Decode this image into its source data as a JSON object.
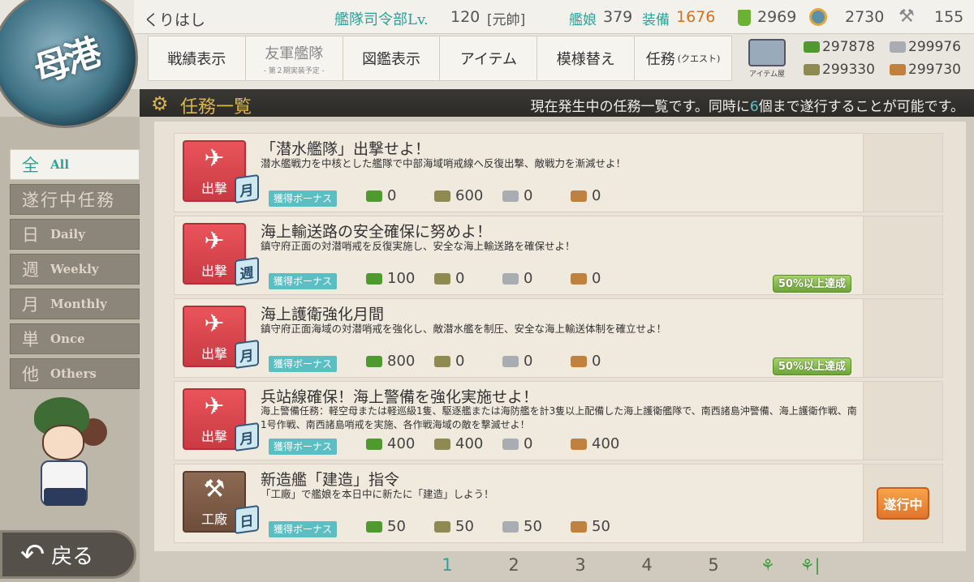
{
  "port": {
    "label": "母港"
  },
  "header": {
    "username": "くりはし",
    "hq_label": "艦隊司令部Lv.",
    "hq_level": "120",
    "hq_rank": "[元帥]",
    "ships_label": "艦娘",
    "ships_count": "379",
    "equip_label": "装備",
    "equip_count": "1676",
    "buckets": "2969",
    "devmats": "2730",
    "screws": "155"
  },
  "nav": {
    "items": [
      {
        "label": "戦績表示"
      },
      {
        "label": "友軍艦隊",
        "sub": "- 第２期実装予定 -"
      },
      {
        "label": "図鑑表示"
      },
      {
        "label": "アイテム"
      },
      {
        "label": "模様替え"
      },
      {
        "label": "任務",
        "small": "(クエスト)"
      }
    ],
    "item_shop_label": "アイテム屋"
  },
  "resources": {
    "fuel": "297878",
    "ammo": "299330",
    "steel": "299976",
    "bauxite": "299730"
  },
  "title_bar": {
    "title": "任務一覧",
    "desc_before": "現在発生中の任務一覧です。同時に",
    "desc_number": "6",
    "desc_after": "個まで遂行することが可能です。"
  },
  "sidebar": {
    "tabs": [
      {
        "kanji": "全",
        "en": "All"
      },
      {
        "kanji": "遂行中任務",
        "en": ""
      },
      {
        "kanji": "日",
        "en": "Daily"
      },
      {
        "kanji": "週",
        "en": "Weekly"
      },
      {
        "kanji": "月",
        "en": "Monthly"
      },
      {
        "kanji": "単",
        "en": "Once"
      },
      {
        "kanji": "他",
        "en": "Others"
      }
    ],
    "back_label": "戻る"
  },
  "quests": [
    {
      "category": "出撃",
      "frequency": "月",
      "title": "「潜水艦隊」出撃せよ！",
      "desc": "潜水艦戦力を中核とした艦隊で中部海域哨戒線へ反復出撃、敵戦力を漸減せよ！",
      "bonus_label": "獲得ボーナス",
      "fuel": "0",
      "ammo": "600",
      "steel": "0",
      "bauxite": "0",
      "progress": "",
      "status": ""
    },
    {
      "category": "出撃",
      "frequency": "週",
      "title": "海上輸送路の安全確保に努めよ！",
      "desc": "鎮守府正面の対潜哨戒を反復実施し、安全な海上輸送路を確保せよ！",
      "bonus_label": "獲得ボーナス",
      "fuel": "100",
      "ammo": "0",
      "steel": "0",
      "bauxite": "0",
      "progress": "50%以上達成",
      "status": ""
    },
    {
      "category": "出撃",
      "frequency": "月",
      "title": "海上護衛強化月間",
      "desc": "鎮守府正面海域の対潜哨戒を強化し、敵潜水艦を制圧、安全な海上輸送体制を確立せよ！",
      "bonus_label": "獲得ボーナス",
      "fuel": "800",
      "ammo": "0",
      "steel": "0",
      "bauxite": "0",
      "progress": "50%以上達成",
      "status": ""
    },
    {
      "category": "出撃",
      "frequency": "月",
      "title": "兵站線確保！海上警備を強化実施せよ！",
      "desc": "海上警備任務：軽空母または軽巡級1隻、駆逐艦または海防艦を計3隻以上配備した海上護衛艦隊で、南西諸島沖警備、海上護衛作戦、南1号作戦、南西諸島哨戒を実施、各作戦海域の敵を撃滅せよ！",
      "bonus_label": "獲得ボーナス",
      "fuel": "400",
      "ammo": "400",
      "steel": "0",
      "bauxite": "400",
      "progress": "",
      "status": ""
    },
    {
      "category": "工廠",
      "frequency": "日",
      "title": "新造艦「建造」指令",
      "desc": "「工廠」で艦娘を本日中に新たに「建造」しよう！",
      "bonus_label": "獲得ボーナス",
      "fuel": "50",
      "ammo": "50",
      "steel": "50",
      "bauxite": "50",
      "progress": "",
      "status": "遂行中"
    }
  ],
  "pagination": {
    "pages": [
      "1",
      "2",
      "3",
      "4",
      "5"
    ],
    "current": "1"
  }
}
